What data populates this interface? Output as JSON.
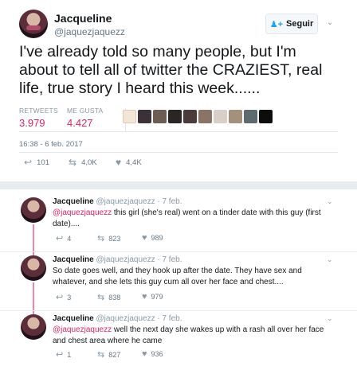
{
  "main_tweet": {
    "display_name": "Jacqueline",
    "handle": "@jaquezjaquezz",
    "follow_label": "Seguir",
    "text": "I've already told so many people, but I'm about to tell all of twitter the CRAZIEST, real life, true story I heard this week......",
    "retweets_label": "RETWEETS",
    "retweets_value": "3.979",
    "likes_label": "ME GUSTA",
    "likes_value": "4.427",
    "timestamp": "16:38 - 6 feb. 2017",
    "reply_count": "101",
    "retweet_count": "4,0K",
    "like_count": "4,4K"
  },
  "replies": [
    {
      "display_name": "Jacqueline",
      "meta": "@jaquezjaquezz · 7 feb.",
      "mention": "@jaquezjaquezz",
      "text": " this girl (she's real) went on a tinder date with this guy (first date)....",
      "reply_count": "4",
      "retweet_count": "823",
      "like_count": "989"
    },
    {
      "display_name": "Jacqueline",
      "meta": "@jaquezjaquezz · 7 feb.",
      "mention": "",
      "text": "So date goes well, and they hook up after the date. They have sex and whatever, and she lets this guy cum all over her face and chest....",
      "reply_count": "3",
      "retweet_count": "838",
      "like_count": "979"
    },
    {
      "display_name": "Jacqueline",
      "meta": "@jaquezjaquezz · 7 feb.",
      "mention": "@jaquezjaquezz",
      "text": " well the next day she wakes up with a rash all over her face and chest area where he came",
      "reply_count": "1",
      "retweet_count": "827",
      "like_count": "936"
    }
  ],
  "icons": {
    "reply": "reply-icon",
    "retweet": "retweet-icon",
    "like": "heart-icon",
    "caret": "chevron-down-icon",
    "follow": "add-person-icon"
  },
  "colors": {
    "like_accent": "#e0245e",
    "link_blue": "#1da1f2",
    "muted": "#657786",
    "separator": "#e6ecf0"
  }
}
